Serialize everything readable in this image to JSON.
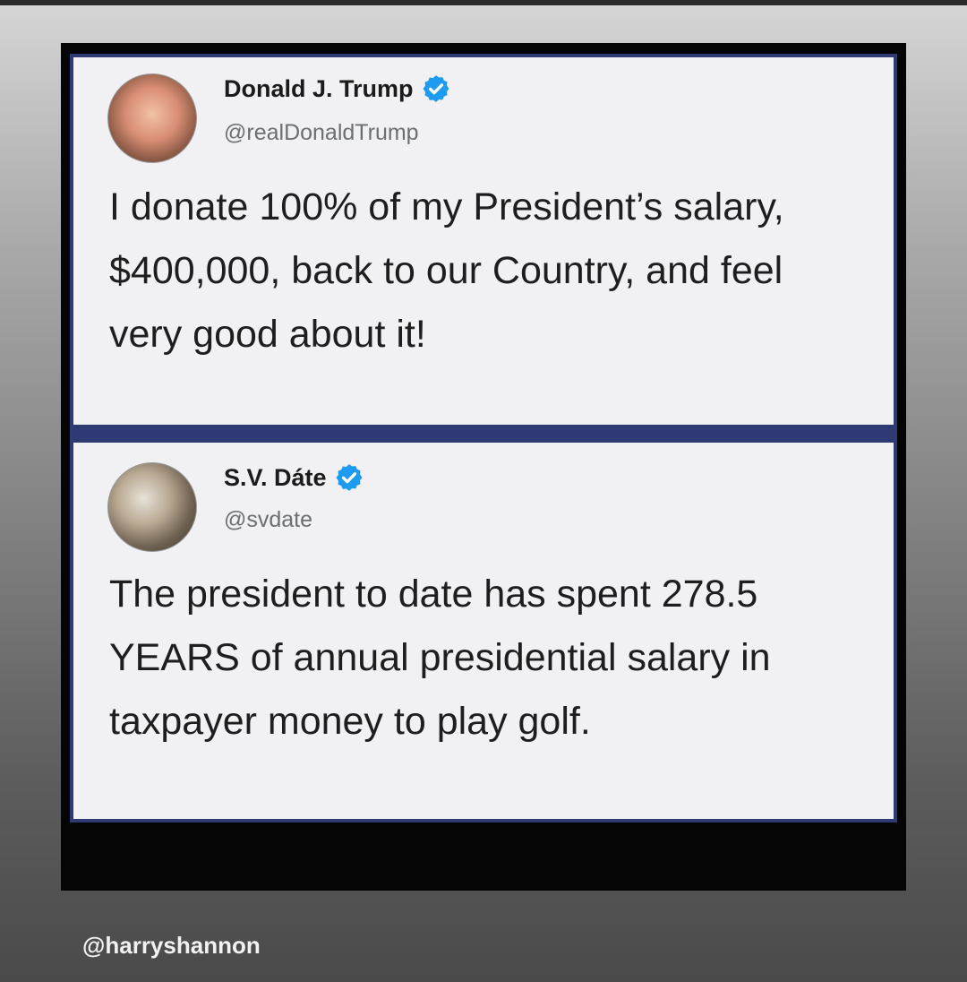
{
  "tweets": [
    {
      "display_name": "Donald J. Trump",
      "handle": "@realDonaldTrump",
      "verified": true,
      "text": "I donate 100% of my President’s salary, $400,000, back to our Country, and feel very good about it!"
    },
    {
      "display_name": "S.V. Dáte",
      "handle": "@svdate",
      "verified": true,
      "text": "The president to date has spent 278.5 YEARS of annual presidential salary in taxpayer money to play golf."
    }
  ],
  "watermark": "@harryshannon",
  "colors": {
    "verified_badge": "#1d9bf0",
    "tweet_background": "#f1f1f3",
    "frame_border": "#2f3a74"
  }
}
